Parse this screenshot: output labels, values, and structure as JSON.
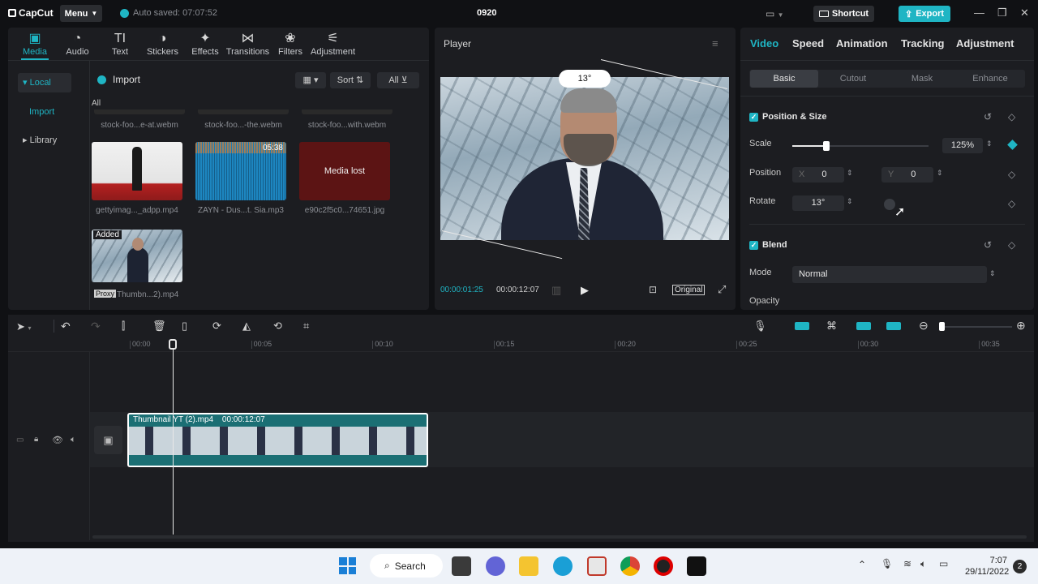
{
  "app": {
    "logo": "CapCut",
    "menu_label": "Menu",
    "autosave": "Auto saved: 07:07:52",
    "project_title": "0920",
    "shortcut_label": "Shortcut",
    "export_label": "Export"
  },
  "media": {
    "tools": [
      {
        "label": "Media",
        "icon": "media-icon"
      },
      {
        "label": "Audio",
        "icon": "audio-icon"
      },
      {
        "label": "Text",
        "icon": "text-icon"
      },
      {
        "label": "Stickers",
        "icon": "stickers-icon"
      },
      {
        "label": "Effects",
        "icon": "effects-icon"
      },
      {
        "label": "Transitions",
        "icon": "transitions-icon"
      },
      {
        "label": "Filters",
        "icon": "filters-icon"
      },
      {
        "label": "Adjustment",
        "icon": "adjustment-icon"
      }
    ],
    "sidebar": [
      "Local",
      "Import",
      "Library"
    ],
    "import_label": "Import",
    "sort_label": "Sort",
    "filter_label": "All",
    "all_label": "All",
    "top_captions": [
      "stock-foo...e-at.webm",
      "stock-foo...-the.webm",
      "stock-foo...with.webm"
    ],
    "items": [
      {
        "caption": "gettyimag..._adpp.mp4"
      },
      {
        "caption": "ZAYN - Dus...t. Sia.mp3",
        "duration": "05:38"
      },
      {
        "caption": "e90c2f5c0...74651.jpg",
        "overlay": "Media lost"
      }
    ],
    "added_item": {
      "caption": "Thumbn...2).mp4",
      "badge": "Added",
      "proxy": "Proxy"
    }
  },
  "player": {
    "title": "Player",
    "rotation_badge": "13°",
    "current_time": "00:00:01:25",
    "total_time": "00:00:12:07",
    "original_label": "Original"
  },
  "props": {
    "tabs": [
      "Video",
      "Speed",
      "Animation",
      "Tracking",
      "Adjustment"
    ],
    "subtabs": [
      "Basic",
      "Cutout",
      "Mask",
      "Enhance"
    ],
    "position_size_title": "Position & Size",
    "scale_label": "Scale",
    "scale_value": "125%",
    "scale_fraction": 0.25,
    "position_label": "Position",
    "x_label": "X",
    "x_value": "0",
    "y_label": "Y",
    "y_value": "0",
    "rotate_label": "Rotate",
    "rotate_value": "13°",
    "blend_title": "Blend",
    "mode_label": "Mode",
    "mode_value": "Normal",
    "opacity_label": "Opacity"
  },
  "timeline": {
    "ticks": [
      "00:00",
      "00:05",
      "00:10",
      "00:15",
      "00:20",
      "00:25",
      "00:30",
      "00:35"
    ],
    "clip_name": "Thumbnail YT (2).mp4",
    "clip_duration": "00:00:12:07"
  },
  "taskbar": {
    "search_label": "Search",
    "time": "7:07",
    "date": "29/11/2022",
    "notification_count": "2"
  },
  "colors": {
    "accent": "#1fb5c4",
    "clip": "#1b6f74",
    "media_lost": "#5c1414"
  }
}
